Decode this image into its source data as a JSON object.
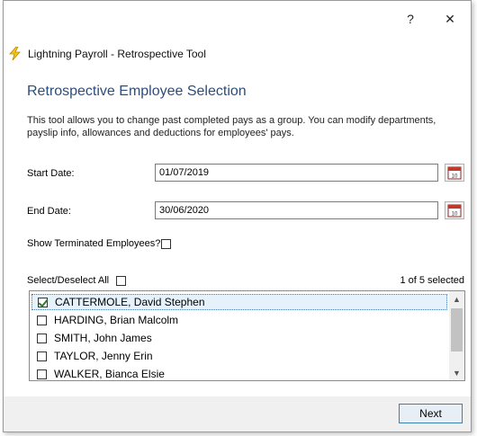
{
  "titlebar": {
    "help_label": "?",
    "close_label": "✕"
  },
  "app": {
    "title": "Lightning Payroll - Retrospective Tool",
    "icon": "lightning-bolt-icon",
    "accent": "#2e4d7b"
  },
  "page": {
    "heading": "Retrospective Employee Selection",
    "description": "This tool allows you to change past completed pays as a group. You can modify departments, payslip info, allowances and deductions for employees' pays."
  },
  "form": {
    "start_date_label": "Start Date:",
    "start_date_value": "01/07/2019",
    "end_date_label": "End Date:",
    "end_date_value": "30/06/2020",
    "calendar_icon_text": "10",
    "show_terminated_label": "Show Terminated Employees?",
    "show_terminated_checked": false
  },
  "selection": {
    "select_all_label": "Select/Deselect All",
    "select_all_checked": false,
    "count_text": "1 of 5 selected"
  },
  "employees": [
    {
      "name": "CATTERMOLE, David Stephen",
      "checked": true,
      "selected": true
    },
    {
      "name": "HARDING, Brian Malcolm",
      "checked": false,
      "selected": false
    },
    {
      "name": "SMITH, John James",
      "checked": false,
      "selected": false
    },
    {
      "name": "TAYLOR, Jenny Erin",
      "checked": false,
      "selected": false
    },
    {
      "name": "WALKER, Bianca Elsie",
      "checked": false,
      "selected": false
    }
  ],
  "scrollbar": {
    "up_arrow": "▲",
    "down_arrow": "▼"
  },
  "footer": {
    "next_label": "Next"
  }
}
